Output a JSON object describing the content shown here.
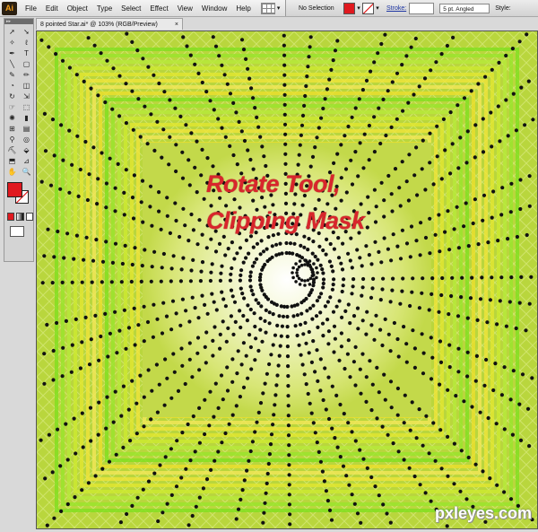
{
  "app": {
    "logo_text": "Ai"
  },
  "menu": [
    "File",
    "Edit",
    "Object",
    "Type",
    "Select",
    "Effect",
    "View",
    "Window",
    "Help"
  ],
  "control_panel": {
    "selection": "No Selection",
    "fill_color": "#e0191f",
    "stroke_label": "Stroke:",
    "brush": "5 pt. Angled",
    "style_label": "Style:"
  },
  "document": {
    "tab_title": "8 pointed Star.ai* @ 103% (RGB/Preview)",
    "close_glyph": "×"
  },
  "artwork": {
    "caption_line1": "Rotate Tool,",
    "caption_line2": "Clipping Mask",
    "caption_color": "#d8262c",
    "star_points": 8,
    "watermark": "pxleyes.com"
  },
  "toolbox": {
    "tools": [
      "selection-icon",
      "direct-selection-icon",
      "magic-wand-icon",
      "lasso-icon",
      "pen-icon",
      "type-icon",
      "line-icon",
      "rectangle-icon",
      "paintbrush-icon",
      "pencil-icon",
      "blob-brush-icon",
      "eraser-icon",
      "rotate-icon",
      "scale-icon",
      "warp-icon",
      "free-transform-icon",
      "symbol-sprayer-icon",
      "graph-icon",
      "mesh-icon",
      "gradient-icon",
      "eyedropper-icon",
      "blend-icon",
      "live-paint-icon",
      "live-paint-selection-icon",
      "artboard-icon",
      "slice-icon",
      "hand-icon",
      "zoom-icon"
    ],
    "fill_color": "#e0191f"
  }
}
